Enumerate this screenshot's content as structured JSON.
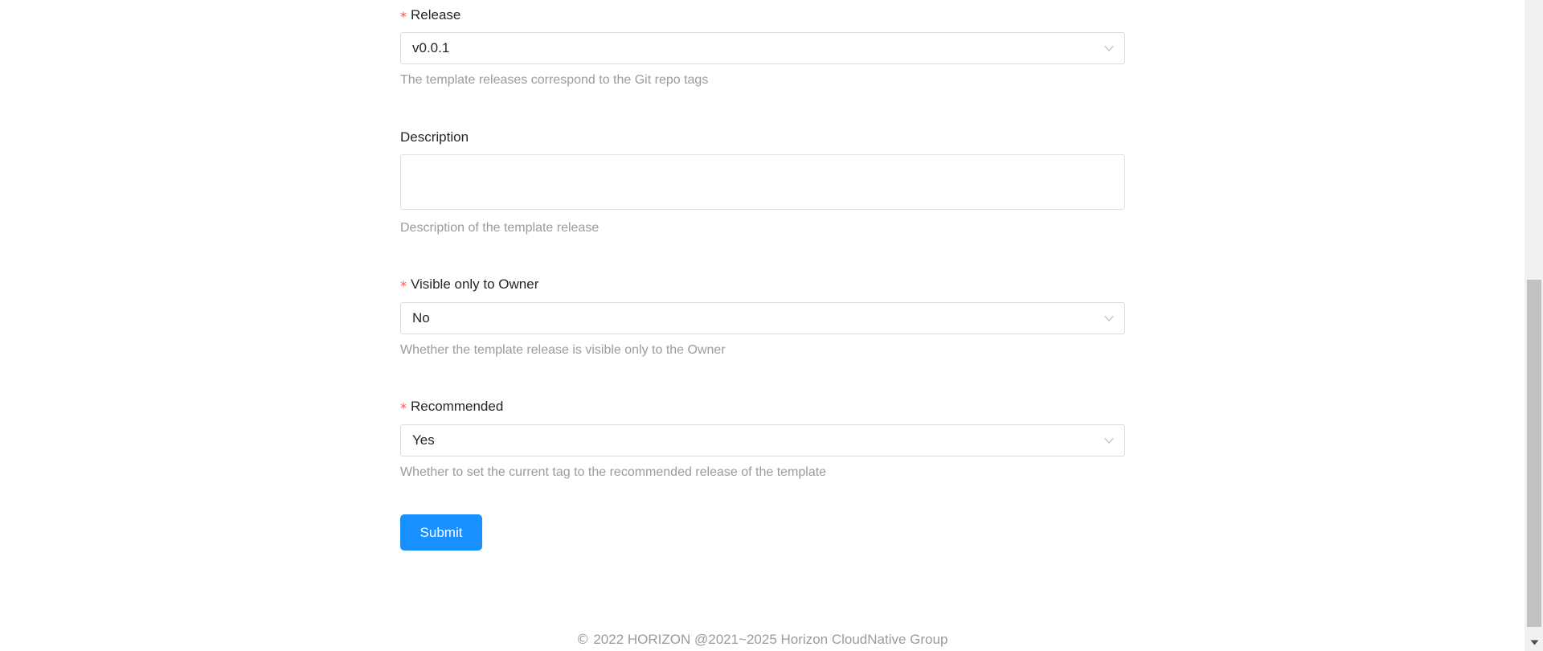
{
  "page": {
    "top_hairline": true
  },
  "form": {
    "fields": [
      {
        "label": "Release",
        "required_marker": "*",
        "control": "select",
        "value": "v0.0.1",
        "help": "The template releases correspond to the Git repo tags",
        "chevron_icon": "chevron-down-icon"
      },
      {
        "label": "Description",
        "required_marker": "",
        "control": "textarea",
        "value": "",
        "placeholder": "",
        "help": "Description of the template release"
      },
      {
        "label": "Visible only to Owner",
        "required_marker": "*",
        "control": "select",
        "value": "No",
        "help": "Whether the template release is visible only to the Owner",
        "chevron_icon": "chevron-down-icon"
      },
      {
        "label": "Recommended",
        "required_marker": "*",
        "control": "select",
        "value": "Yes",
        "help": "Whether to set the current tag to the recommended release of the template",
        "chevron_icon": "chevron-down-icon"
      }
    ],
    "submit_label": "Submit"
  },
  "footer": {
    "copyright_glyph": "©",
    "text": "2022 HORIZON @2021~2025 Horizon CloudNative Group"
  },
  "scrollbar": {
    "arrow_down_icon": "triangle-down-icon"
  },
  "colors": {
    "accent": "#1890ff",
    "required_star": "#ff4d4f",
    "label_text": "#262626",
    "help_text": "#9b9b9b",
    "border": "#d9d9d9",
    "scrollbar_track": "#f1f1f1",
    "scrollbar_thumb": "#c1c1c1"
  }
}
